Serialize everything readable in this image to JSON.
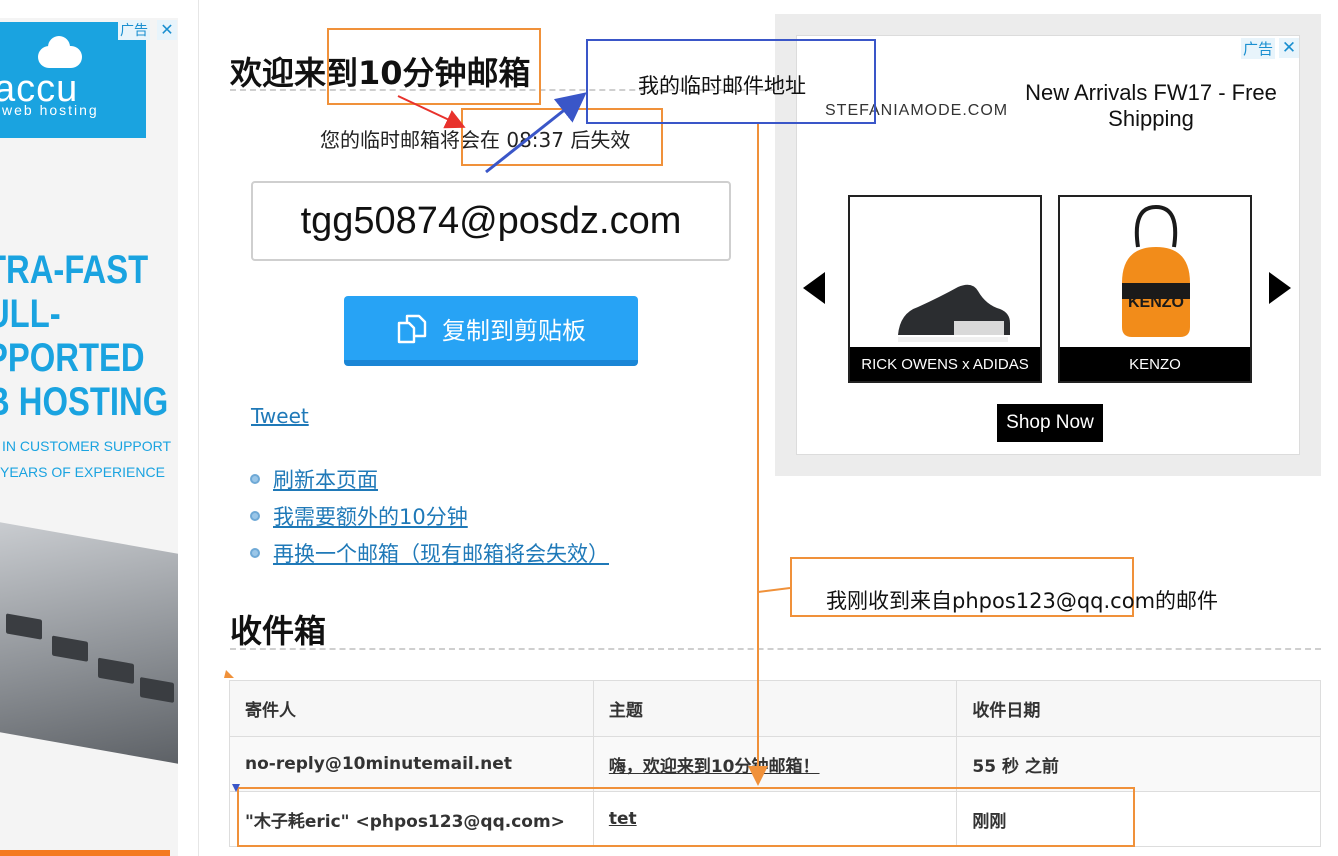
{
  "left_ad": {
    "ad_label": "广告",
    "close_glyph": "✕",
    "brand": "accu",
    "brand_sub": "web hosting",
    "headline_lines": [
      "TRA-FAST",
      "ULL-",
      "PPORTED",
      "B HOSTING"
    ],
    "tagline_1": "IN CUSTOMER SUPPORT",
    "tagline_2": "YEARS OF EXPERIENCE",
    "accent_color": "#1aa3e0"
  },
  "main": {
    "welcome_title": "欢迎来到10分钟邮箱",
    "timer_text": "您的临时邮箱将会在 08:37 后失效",
    "email_address": "tgg50874@posdz.com",
    "copy_button_label": "复制到剪贴板",
    "tweet_label": "Tweet",
    "actions": [
      {
        "label": "刷新本页面"
      },
      {
        "label": "我需要额外的10分钟"
      },
      {
        "label": "再换一个邮箱（现有邮箱将会失效）"
      }
    ]
  },
  "inbox": {
    "title": "收件箱",
    "columns": [
      "寄件人",
      "主题",
      "收件日期"
    ],
    "rows": [
      {
        "sender": "no-reply@10minutemail.net",
        "subject": "嗨，欢迎来到10分钟邮箱！",
        "date": "55 秒 之前"
      },
      {
        "sender": "\"木子耗eric\" <phpos123@qq.com>",
        "subject": "tet",
        "date": "刚刚"
      }
    ]
  },
  "right_ad": {
    "ad_label": "广告",
    "close_glyph": "✕",
    "store_name": "STEFANIAMODE.COM",
    "promo_line_1": "New Arrivals FW17 - Free",
    "promo_line_2": "Shipping",
    "products": [
      {
        "caption": "RICK OWENS x ADIDAS"
      },
      {
        "caption": "KENZO"
      }
    ],
    "shop_button": "Shop Now"
  },
  "annotations": {
    "temp_address_note": "我的临时邮件地址",
    "received_note": "我刚收到来自phpos123@qq.com的邮件",
    "orange_color": "#f0913a",
    "blue_color": "#3a56c8",
    "red_color": "#e8322c"
  }
}
